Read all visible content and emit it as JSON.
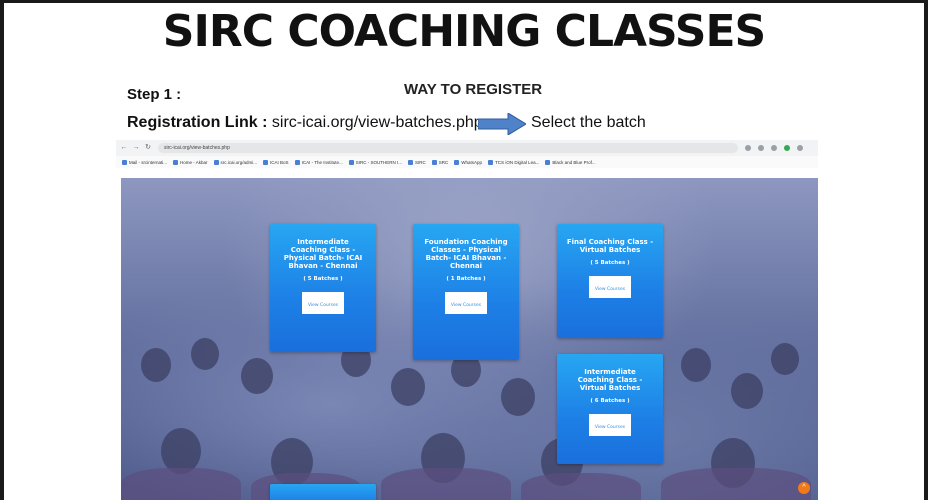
{
  "slide": {
    "title": "SIRC COACHING CLASSES",
    "step_label": "Step 1 :",
    "heading": "WAY TO REGISTER",
    "registration_label": "Registration Link :",
    "registration_url": "sirc-icai.org/view-batches.php",
    "instruction": "Select the batch",
    "arrow_color": "#4f82c8"
  },
  "browser": {
    "url": "sirc-icai.org/view-batches.php",
    "bookmarks": [
      "Mail - srcinternati...",
      "Home - Akbar",
      "src.icai.org/admi...",
      "ICAI BoS",
      "ICAI - The Institute...",
      "SIRC - SOUTHERN I...",
      "SIRC",
      "SRC",
      "WhatsApp",
      "TCS iON Digital Lea...",
      "Black and Blue Prof..."
    ]
  },
  "cards": [
    {
      "title": "Intermediate Coaching Class - Physical Batch- ICAI Bhavan - Chennai",
      "count": "( 5 Batches )",
      "button": "View Courses"
    },
    {
      "title": "Foundation Coaching Classes - Physical Batch- ICAI Bhavan - Chennai",
      "count": "( 1 Batches )",
      "button": "View Courses"
    },
    {
      "title": "Final Coaching Class - Virtual Batches",
      "count": "( 5 Batches )",
      "button": "View Courses"
    },
    {
      "title": "Intermediate Coaching Class - Virtual Batches",
      "count": "( 6 Batches )",
      "button": "View Courses"
    }
  ],
  "colors": {
    "card_gradient_top": "#27a6f2",
    "card_gradient_bottom": "#1a6fdc",
    "scroll_button": "#f07a1a"
  }
}
